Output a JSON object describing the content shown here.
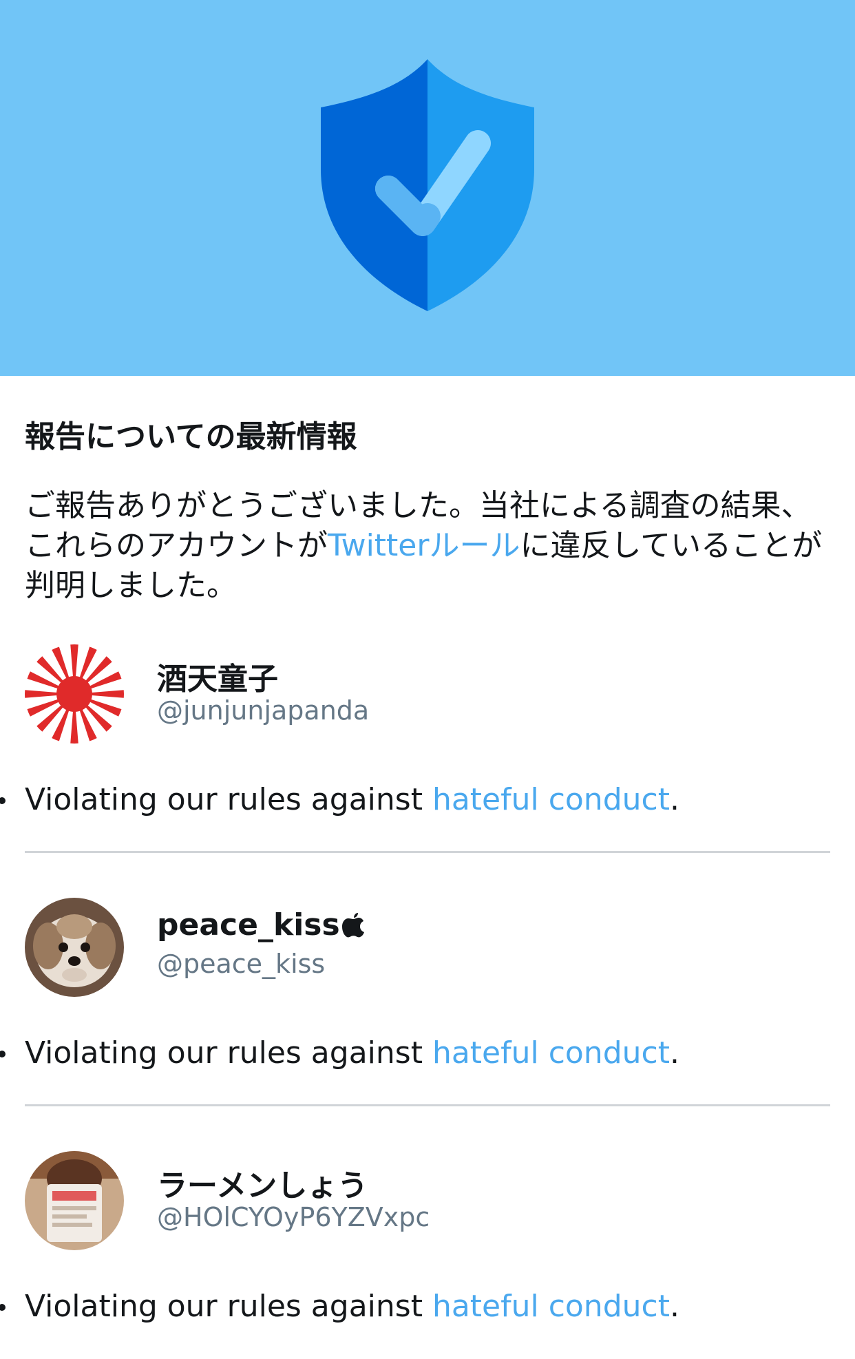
{
  "hero": {
    "icon": "shield-check-icon",
    "background_color": "#71c5f7",
    "shield_dark": "#0066d6",
    "shield_light": "#1e9cf0",
    "check_color": "#8fd6ff"
  },
  "report": {
    "title": "報告についての最新情報",
    "message_before": "ご報告ありがとうございました。当社による調査の結果、これらのアカウントが",
    "rules_link": "Twitterルール",
    "message_after": "に違反していることが判明しました。",
    "link_color": "#4aa8ee"
  },
  "accounts": [
    {
      "name": "酒天童子",
      "handle": "@junjunjapanda",
      "avatar": "rising-sun-flag-avatar",
      "violation_prefix": "Violating our rules against ",
      "violation_link": "hateful conduct",
      "violation_suffix": "."
    },
    {
      "name": "peace_kiss",
      "name_icon": "apple-icon",
      "handle": "@peace_kiss",
      "avatar": "dog-avatar",
      "violation_prefix": "Violating our rules against ",
      "violation_link": "hateful conduct",
      "violation_suffix": "."
    },
    {
      "name": "ラーメンしょう",
      "handle": "@HOlCYOyP6YZVxpc",
      "avatar": "photo-avatar",
      "violation_prefix": "Violating our rules against ",
      "violation_link": "hateful conduct",
      "violation_suffix": "."
    }
  ]
}
